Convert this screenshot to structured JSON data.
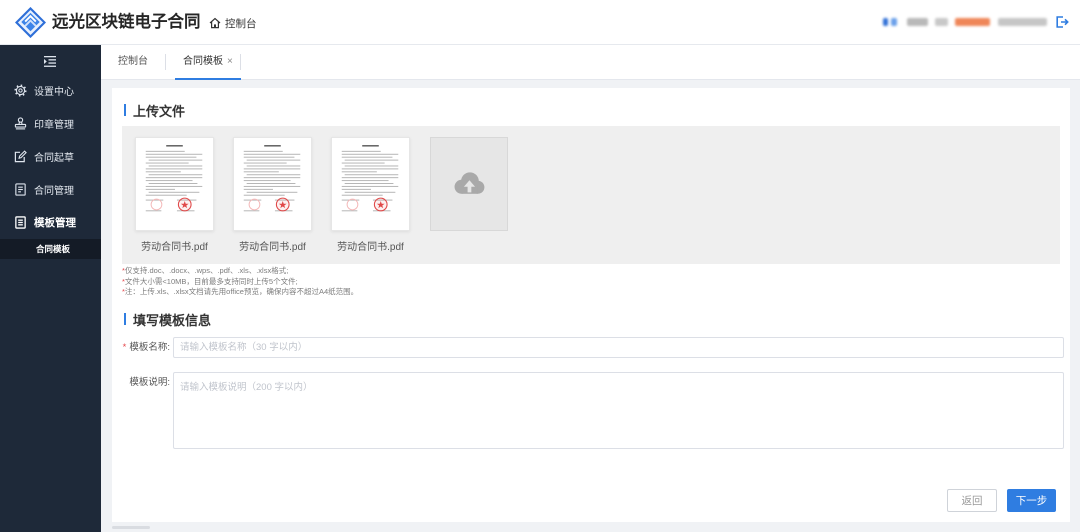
{
  "header": {
    "title": "远光区块链电子合同",
    "home_label": "控制台",
    "logo_icon": "app-logo-icon",
    "home_icon": "home-icon",
    "logout_icon": "logout-icon"
  },
  "sidebar": {
    "toggle_icon": "menu-fold-icon",
    "items": [
      {
        "label": "设置中心",
        "icon": "gear-icon"
      },
      {
        "label": "印章管理",
        "icon": "stamp-icon"
      },
      {
        "label": "合同起草",
        "icon": "edit-icon"
      },
      {
        "label": "合同管理",
        "icon": "document-icon"
      },
      {
        "label": "模板管理",
        "icon": "template-icon",
        "expanded": true
      }
    ],
    "sub_items": [
      {
        "label": "合同模板",
        "active": true
      }
    ]
  },
  "tabs": [
    {
      "label": "控制台",
      "active": false
    },
    {
      "label": "合同模板",
      "active": true,
      "close": "×"
    }
  ],
  "upload": {
    "title": "上传文件",
    "files": [
      {
        "name": "劳动合同书.pdf"
      },
      {
        "name": "劳动合同书.pdf"
      },
      {
        "name": "劳动合同书.pdf"
      }
    ],
    "upload_icon": "cloud-upload-icon",
    "hints": [
      {
        "mark": "*",
        "text": "仅支持.doc、.docx、.wps、.pdf、.xls、.xlsx格式;"
      },
      {
        "mark": "*",
        "text": "文件大小需<10MB，目前最多支持同时上传5个文件;"
      },
      {
        "mark": "*",
        "text": "注：上传.xls、.xlsx文档请先用office预览，确保内容不超过A4纸范围。"
      }
    ]
  },
  "form": {
    "title": "填写模板信息",
    "name": {
      "required": "*",
      "label": "模板名称:",
      "placeholder": "请输入模板名称（30 字以内）"
    },
    "description": {
      "label": "模板说明:",
      "placeholder": "请输入模板说明（200 字以内）"
    }
  },
  "actions": {
    "back": "返回",
    "next": "下一步"
  },
  "colors": {
    "primary": "#2f7de1",
    "sidebar_bg": "#1e2939",
    "sidebar_active_bg": "#141b26",
    "required": "#e5484d",
    "page_bg": "#f0f2f5"
  }
}
